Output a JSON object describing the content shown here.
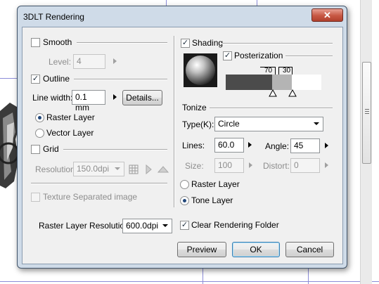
{
  "dialog": {
    "title": "3DLT Rendering",
    "close_glyph": "✕"
  },
  "left": {
    "smooth_label": "Smooth",
    "smooth_checked": false,
    "level_label": "Level:",
    "level_value": "4",
    "outline_label": "Outline",
    "outline_checked": true,
    "line_width_label": "Line width:",
    "line_width_value": "0.1 mm",
    "details_label": "Details...",
    "raster_layer_label": "Raster Layer",
    "vector_layer_label": "Vector Layer",
    "layer_selected": "raster",
    "grid_label": "Grid",
    "grid_checked": false,
    "resolution_label": "Resolution:",
    "resolution_value": "150.0dpi",
    "texture_label": "Texture Separated image",
    "texture_checked": false
  },
  "right": {
    "shading_label": "Shading",
    "shading_checked": true,
    "posterization_label": "Posterization",
    "posterization_checked": true,
    "poster_value_1": "70",
    "poster_value_2": "30",
    "poster_colors": [
      "#4b4b4b",
      "#b4b4b4",
      "#ffffff"
    ],
    "tonize_label": "Tonize",
    "type_label": "Type(K):",
    "type_value": "Circle",
    "lines_label": "Lines:",
    "lines_value": "60.0",
    "angle_label": "Angle:",
    "angle_value": "45",
    "size_label": "Size:",
    "size_value": "100",
    "distort_label": "Distort:",
    "distort_value": "0",
    "raster_layer_label": "Raster Layer",
    "tone_layer_label": "Tone Layer",
    "tone_selected": "tone"
  },
  "footer": {
    "raster_res_label": "Raster Layer Resolution:",
    "raster_res_value": "600.0dpi",
    "clear_folder_label": "Clear Rendering Folder",
    "clear_folder_checked": true,
    "preview_label": "Preview",
    "ok_label": "OK",
    "cancel_label": "Cancel"
  },
  "colors": {
    "frame": "#cfdbe8",
    "close": "#c75743",
    "canvas_guides": "#8c8cd8"
  },
  "check_glyph": "✓"
}
